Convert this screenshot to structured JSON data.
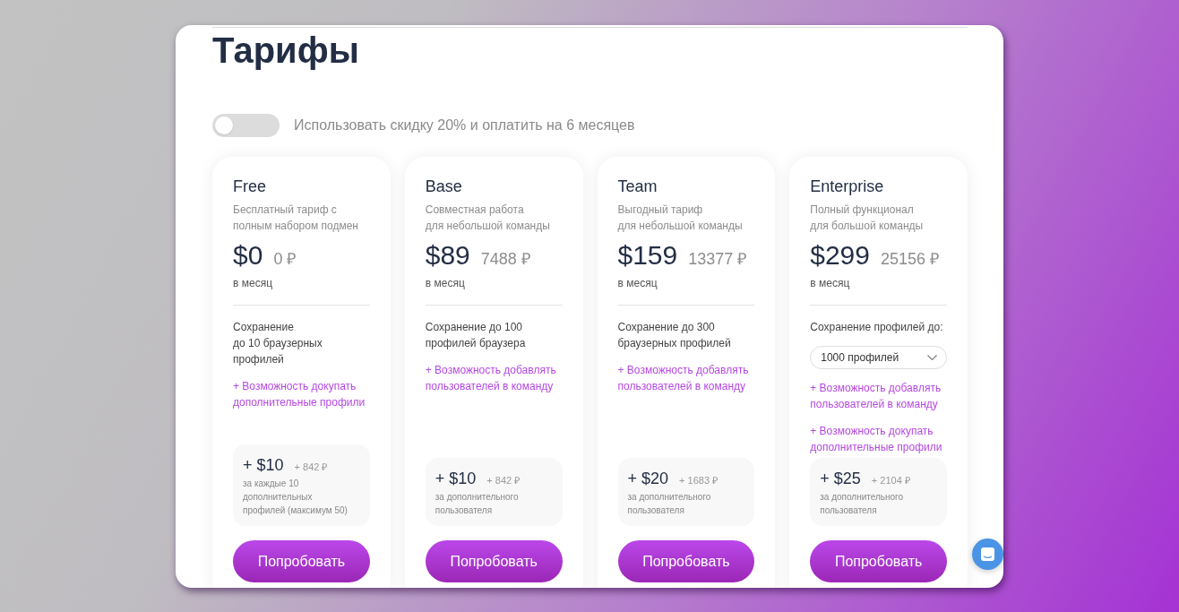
{
  "title": "Тарифы",
  "discount_toggle": {
    "on": false,
    "label": "Использовать скидку 20% и оплатить на 6 месяцев"
  },
  "plans": [
    {
      "name": "Free",
      "description": "Бесплатный тариф с\nполным набором подмен",
      "price": "$0",
      "price_rub": "0 ₽",
      "period": "в месяц",
      "features": [
        {
          "kind": "text",
          "text": "Сохранение\nдо 10 браузерных\nпрофилей"
        },
        {
          "kind": "extra",
          "text": "+ Возможность докупать\nдополнительные профили"
        }
      ],
      "addon": {
        "price": "+ $10",
        "price_rub": "+ 842 ₽",
        "note": "за каждые 10\nдополнительных\nпрофилей (максимум 50)"
      },
      "button": "Попробовать"
    },
    {
      "name": "Base",
      "description": "Совместная работа\nдля небольшой команды",
      "price": "$89",
      "price_rub": "7488 ₽",
      "period": "в месяц",
      "features": [
        {
          "kind": "text",
          "text": "Сохранение до 100\nпрофилей браузера"
        },
        {
          "kind": "extra",
          "text": "+ Возможность добавлять\nпользователей в команду"
        }
      ],
      "addon": {
        "price": "+ $10",
        "price_rub": "+ 842 ₽",
        "note": "за дополнительного\nпользователя"
      },
      "button": "Попробовать"
    },
    {
      "name": "Team",
      "description": "Выгодный тариф\nдля небольшой команды",
      "price": "$159",
      "price_rub": "13377 ₽",
      "period": "в месяц",
      "features": [
        {
          "kind": "text",
          "text": "Сохранение до 300\nбраузерных профилей"
        },
        {
          "kind": "extra",
          "text": "+ Возможность добавлять\nпользователей в команду"
        }
      ],
      "addon": {
        "price": "+ $20",
        "price_rub": "+ 1683 ₽",
        "note": "за дополнительного\nпользователя"
      },
      "button": "Попробовать"
    },
    {
      "name": "Enterprise",
      "description": "Полный функционал\nдля большой команды",
      "price": "$299",
      "price_rub": "25156 ₽",
      "period": "в месяц",
      "features": [
        {
          "kind": "text",
          "text": "Сохранение профилей до:"
        },
        {
          "kind": "select",
          "value": "1000 профилей"
        },
        {
          "kind": "extra",
          "text": "+ Возможность добавлять\nпользователей в команду"
        },
        {
          "kind": "extra",
          "text": "+ Возможность докупать\nдополнительные профили"
        }
      ],
      "addon": {
        "price": "+ $25",
        "price_rub": "+ 2104 ₽",
        "note": "за дополнительного\nпользователя"
      },
      "button": "Попробовать"
    }
  ]
}
